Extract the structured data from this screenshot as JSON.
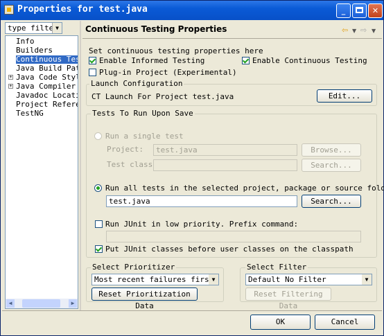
{
  "window": {
    "title": "Properties for test.java"
  },
  "left": {
    "filter_text": "type filter",
    "tree": [
      {
        "label": "Info",
        "selected": false,
        "expandable": false
      },
      {
        "label": "Builders",
        "selected": false,
        "expandable": false
      },
      {
        "label": "Continuous Test",
        "selected": true,
        "expandable": false
      },
      {
        "label": "Java Build Path",
        "selected": false,
        "expandable": false
      },
      {
        "label": "Java Code Style",
        "selected": false,
        "expandable": true
      },
      {
        "label": "Java Compiler",
        "selected": false,
        "expandable": true
      },
      {
        "label": "Javadoc Location",
        "selected": false,
        "expandable": false
      },
      {
        "label": "Project Referen",
        "selected": false,
        "expandable": false
      },
      {
        "label": "TestNG",
        "selected": false,
        "expandable": false
      }
    ]
  },
  "page": {
    "title": "Continuous Testing Properties",
    "intro": "Set continuous testing properties here",
    "informed_testing": {
      "label": "Enable Informed Testing",
      "checked": true
    },
    "continuous_testing": {
      "label": "Enable Continuous Testing",
      "checked": true
    },
    "plugin_project": {
      "label": "Plug-in Project (Experimental)",
      "checked": false
    },
    "launch": {
      "group_label": "Launch Configuration",
      "text": "CT Launch For Project test.java",
      "edit_button": "Edit..."
    },
    "tests": {
      "group_label": "Tests To Run Upon Save",
      "single_test_label": "Run a single test",
      "project_label": "Project:",
      "project_value": "test.java",
      "browse_button": "Browse...",
      "test_class_label": "Test class:",
      "test_class_value": "",
      "search_button_1": "Search...",
      "all_tests_label": "Run all tests in the selected project, package or source folder:",
      "all_tests_value": "test.java",
      "search_button_2": "Search...",
      "low_priority_label": "Run JUnit in low priority.  Prefix command:",
      "low_priority_checked": false,
      "prefix_value": "",
      "junit_first_label": "Put JUnit classes before user classes on the classpath",
      "junit_first_checked": true
    },
    "prioritizer": {
      "group_label": "Select Prioritizer",
      "selected": "Most recent failures first",
      "reset_button": "Reset Prioritization Data"
    },
    "filter": {
      "group_label": "Select Filter",
      "selected": "Default No Filter",
      "reset_button": "Reset Filtering Data"
    }
  },
  "buttons": {
    "ok": "OK",
    "cancel": "Cancel"
  }
}
